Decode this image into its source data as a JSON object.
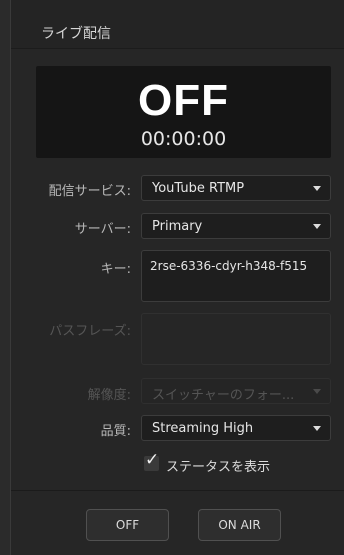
{
  "header": {
    "title": "ライブ配信"
  },
  "status": {
    "state": "OFF",
    "timecode": "00:00:00"
  },
  "form": {
    "service": {
      "label": "配信サービス:",
      "value": "YouTube RTMP"
    },
    "server": {
      "label": "サーバー:",
      "value": "Primary"
    },
    "key": {
      "label": "キー:",
      "value": "2rse-6336-cdyr-h348-f515"
    },
    "passphrase": {
      "label": "パスフレーズ:",
      "value": ""
    },
    "resolution": {
      "label": "解像度:",
      "value": "スイッチャーのフォー..."
    },
    "quality": {
      "label": "品質:",
      "value": "Streaming High"
    },
    "show_status": {
      "label": "ステータスを表示",
      "checked": true
    }
  },
  "buttons": {
    "off": "OFF",
    "on_air": "ON AIR"
  },
  "colors": {
    "panel": "#262626",
    "status_box": "#151515",
    "field": "#1e1e1e"
  }
}
